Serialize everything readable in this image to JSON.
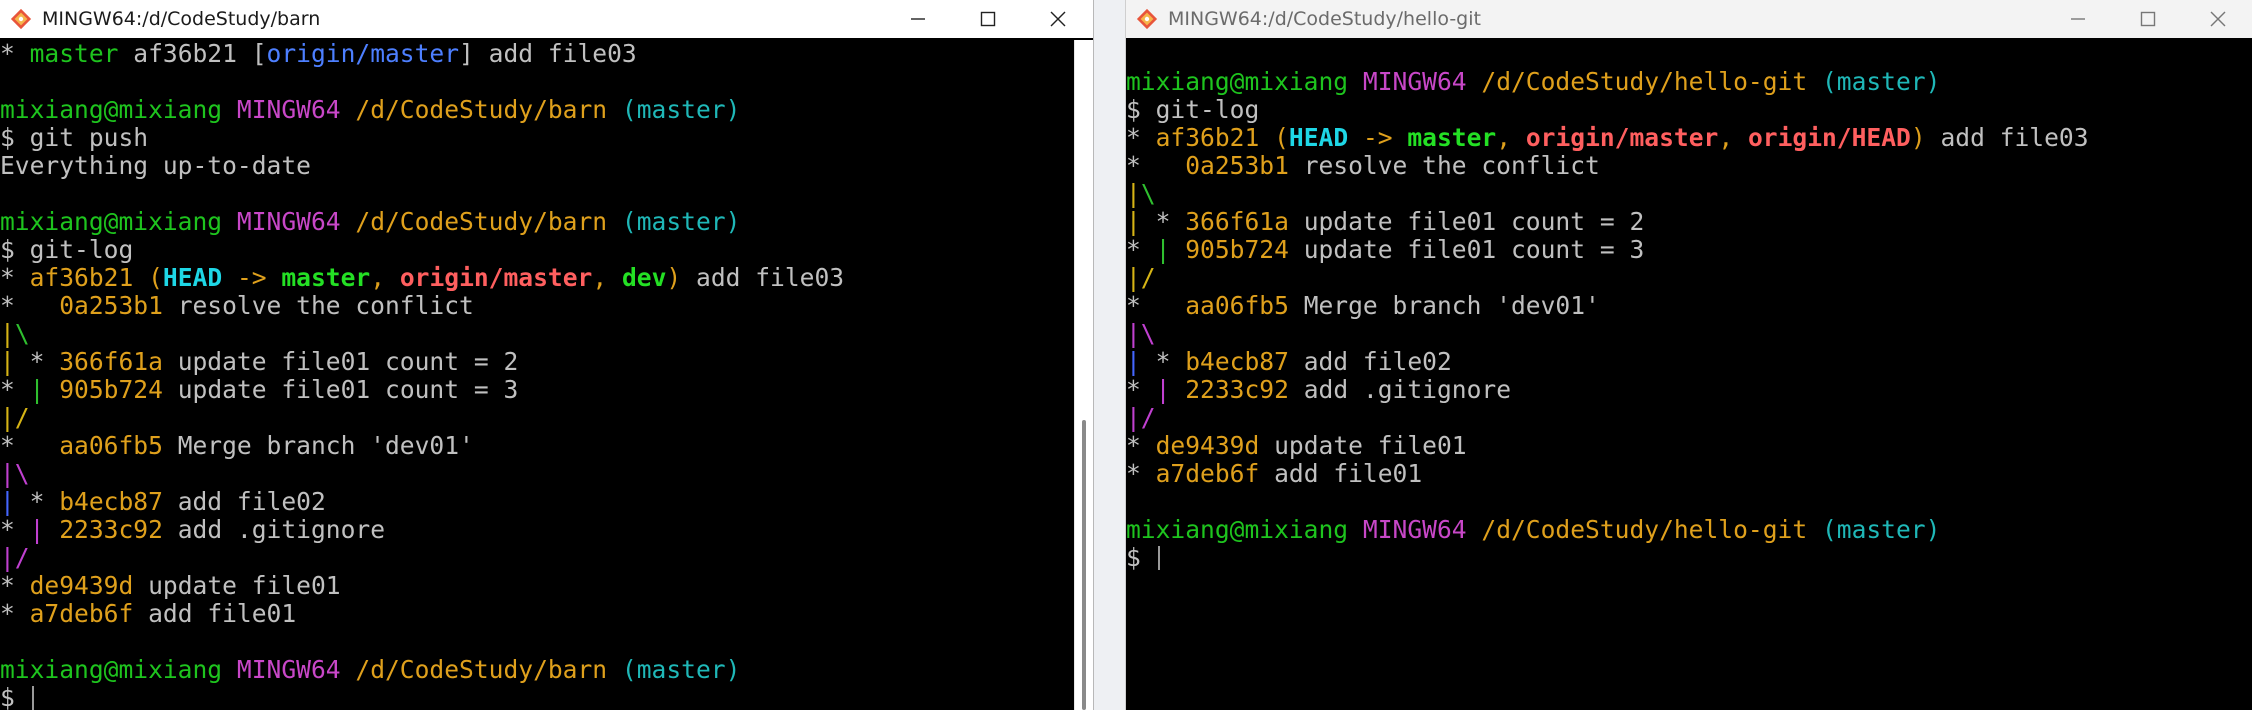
{
  "left": {
    "title": "MINGW64:/d/CodeStudy/barn",
    "prompt": {
      "user": "mixiang@mixiang",
      "sys": "MINGW64",
      "path": "/d/CodeStudy/barn",
      "branch": "(master)"
    },
    "top_line": {
      "star": "* ",
      "branch": "master",
      "hash": " af36b21 [",
      "remote": "origin/master",
      "msg": "] add file03"
    },
    "cmd_push": "$ git push",
    "out_push": "Everything up-to-date",
    "cmd_log": "$ git-log",
    "head_line": {
      "prefix": "* ",
      "hash": "af36b21",
      "open": " (",
      "head": "HEAD",
      "arrow": " -> ",
      "master": "master",
      "sep1": ", ",
      "origin": "origin/master",
      "sep2": ", ",
      "dev": "dev",
      "close": ")",
      "msg": " add file03"
    },
    "resolve": {
      "g": "*   ",
      "hash": "0a253b1",
      "msg": " resolve the conflict"
    },
    "r1a": "|",
    "r1b": "\\",
    "c366": {
      "g1": "|",
      "g2": " * ",
      "hash": "366f61a",
      "msg": " update file01 count = 2"
    },
    "c905": {
      "g1": "* ",
      "g2": "|",
      "sp": " ",
      "hash": "905b724",
      "msg": " update file01 count = 3"
    },
    "r2": "|/",
    "aa06": {
      "g": "*   ",
      "hash": "aa06fb5",
      "msg": " Merge branch 'dev01'"
    },
    "r3": "|\\",
    "b4ec": {
      "g1": "|",
      "g2": " * ",
      "hash": "b4ecb87",
      "msg": " add file02"
    },
    "c223": {
      "g1": "* ",
      "g2": "|",
      "sp": " ",
      "hash": "2233c92",
      "msg": " add .gitignore"
    },
    "r4": "|/",
    "de94": {
      "g": "* ",
      "hash": "de9439d",
      "msg": " update file01"
    },
    "a7de": {
      "g": "* ",
      "hash": "a7deb6f",
      "msg": " add file01"
    },
    "dollar": "$ "
  },
  "right": {
    "title": "MINGW64:/d/CodeStudy/hello-git",
    "prompt": {
      "user": "mixiang@mixiang",
      "sys": "MINGW64",
      "path": "/d/CodeStudy/hello-git",
      "branch": "(master)"
    },
    "cmd_log": "$ git-log",
    "head_line": {
      "prefix": "* ",
      "hash": "af36b21",
      "open": " (",
      "head": "HEAD",
      "arrow": " -> ",
      "master": "master",
      "sep1": ", ",
      "origin": "origin/master",
      "sep2": ", ",
      "originhead": "origin/HEAD",
      "close": ")",
      "msg": " add file03"
    },
    "resolve": {
      "g": "*   ",
      "hash": "0a253b1",
      "msg": " resolve the conflict"
    },
    "r1a": "|",
    "r1b": "\\",
    "c366": {
      "g1": "|",
      "g2": " * ",
      "hash": "366f61a",
      "msg": " update file01 count = 2"
    },
    "c905": {
      "g1": "* ",
      "g2": "|",
      "sp": " ",
      "hash": "905b724",
      "msg": " update file01 count = 3"
    },
    "r2": "|/",
    "aa06": {
      "g": "*   ",
      "hash": "aa06fb5",
      "msg": " Merge branch 'dev01'"
    },
    "r3": "|\\",
    "b4ec": {
      "g1": "|",
      "g2": " * ",
      "hash": "b4ecb87",
      "msg": " add file02"
    },
    "c223": {
      "g1": "* ",
      "g2": "|",
      "sp": " ",
      "hash": "2233c92",
      "msg": " add .gitignore"
    },
    "r4": "|/",
    "de94": {
      "g": "* ",
      "hash": "de9439d",
      "msg": " update file01"
    },
    "a7de": {
      "g": "* ",
      "hash": "a7deb6f",
      "msg": " add file01"
    },
    "dollar": "$ "
  },
  "icons": {
    "app": "git-bash-icon",
    "minimize": "minimize-icon",
    "maximize": "maximize-icon",
    "close": "close-icon"
  },
  "colors": {
    "magenta": "#c847c8",
    "yellow": "#dfa01c",
    "cyan": "#1fb8b8",
    "blue": "#4d7fff",
    "green": "#1ec41e",
    "red": "#ff5f5f"
  }
}
